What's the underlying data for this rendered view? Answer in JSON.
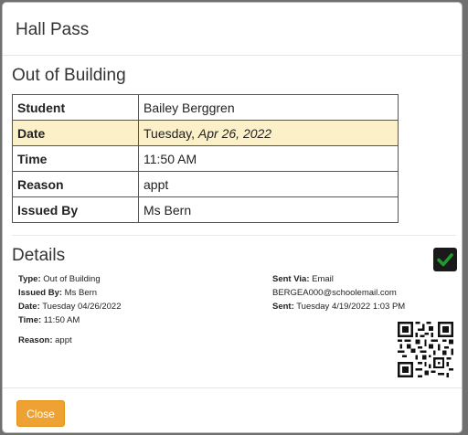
{
  "modal": {
    "title": "Hall Pass"
  },
  "pass": {
    "heading": "Out of Building",
    "rows": [
      {
        "label": "Student",
        "value": "Bailey Berggren"
      },
      {
        "label": "Date",
        "value_prefix": "Tuesday, ",
        "value_italic": "Apr 26, 2022"
      },
      {
        "label": "Time",
        "value": "11:50 AM"
      },
      {
        "label": "Reason",
        "value": "appt"
      },
      {
        "label": "Issued By",
        "value": "Ms Bern"
      }
    ]
  },
  "details": {
    "heading": "Details",
    "left": [
      {
        "key": "Type:",
        "value": " Out of Building"
      },
      {
        "key": "Issued By:",
        "value": " Ms Bern"
      },
      {
        "key": "Date:",
        "value": " Tuesday 04/26/2022"
      },
      {
        "key": "Time:",
        "value": " 11:50 AM"
      },
      {
        "key": "Reason:",
        "value": " appt"
      }
    ],
    "right": {
      "sent_via_key": "Sent Via:",
      "sent_via_value": " Email",
      "email": "BERGEA000@schoolemail.com",
      "sent_key": "Sent:",
      "sent_value": " Tuesday 4/19/2022 1:03 PM"
    },
    "status_icon": "checkmark-icon",
    "status_color": "#1e9a2e"
  },
  "footer": {
    "close_label": "Close"
  },
  "colors": {
    "accent": "#efa234",
    "highlight_row": "#fcf0c8"
  }
}
